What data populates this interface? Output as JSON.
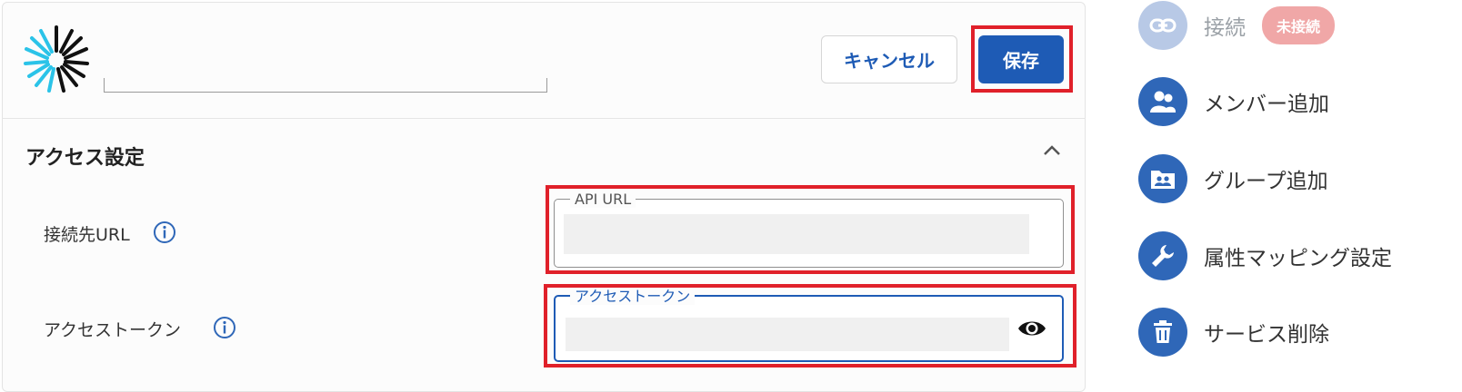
{
  "header": {
    "cancel_label": "キャンセル",
    "save_label": "保存"
  },
  "section": {
    "title": "アクセス設定",
    "fields": [
      {
        "label": "接続先URL",
        "floating_label": "API URL",
        "value": ""
      },
      {
        "label": "アクセストークン",
        "floating_label": "アクセストークン",
        "value": ""
      }
    ]
  },
  "sidebar": {
    "items": [
      {
        "label": "接続",
        "icon": "link-icon",
        "status": "未接続",
        "disabled": true
      },
      {
        "label": "メンバー追加",
        "icon": "people-icon"
      },
      {
        "label": "グループ追加",
        "icon": "group-folder-icon"
      },
      {
        "label": "属性マッピング設定",
        "icon": "wrench-icon"
      },
      {
        "label": "サービス削除",
        "icon": "trash-icon"
      }
    ]
  },
  "colors": {
    "primary": "#1e5bb5",
    "highlight": "#e0202a",
    "sidebar_icon_bg": "#2f67b8",
    "status_badge": "#f0a7a7"
  }
}
